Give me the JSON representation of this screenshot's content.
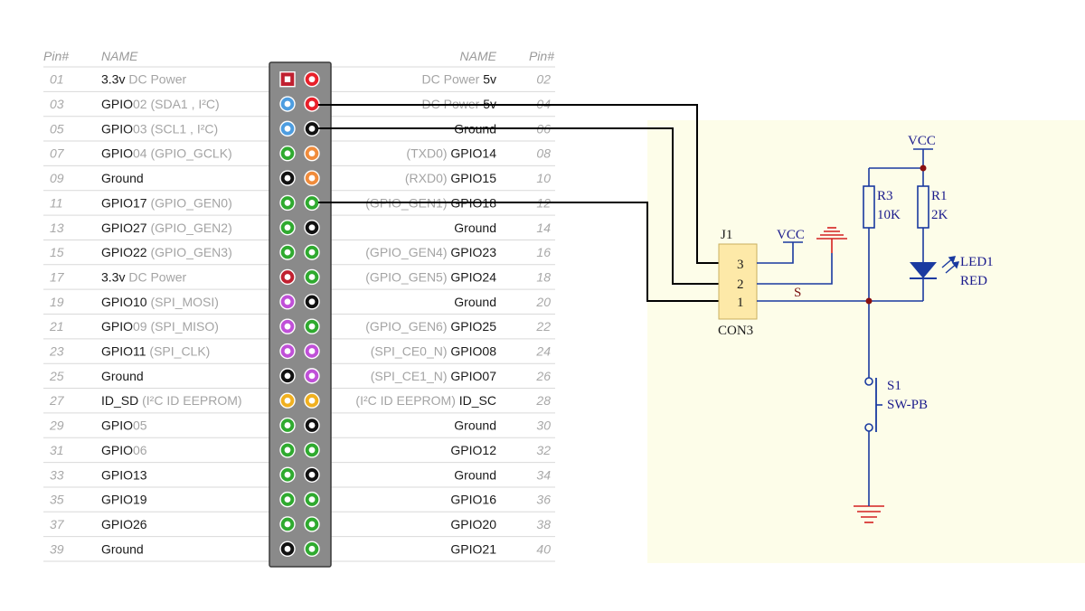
{
  "header": {
    "pin_left": "Pin#",
    "name_left": "NAME",
    "name_right": "NAME",
    "pin_right": "Pin#"
  },
  "colors": {
    "red": "#e8202a",
    "blue": "#4d9de0",
    "green": "#2faa2f",
    "orange": "#f08c3c",
    "black": "#111111",
    "purple": "#c050d8",
    "yellow": "#f0b020",
    "darkred": "#c02030"
  },
  "pins": [
    {
      "left_num": "01",
      "left_main": "3.3v",
      "left_dim": " DC Power",
      "left_color": "darkred",
      "left_square": true,
      "right_num": "02",
      "right_dim": "DC Power ",
      "right_main": "5v",
      "right_color": "red"
    },
    {
      "left_num": "03",
      "left_main": "GPIO",
      "left_dim": "02 (SDA1 , I²C)",
      "left_color": "blue",
      "right_num": "04",
      "right_dim": "DC Power ",
      "right_main": "5v",
      "right_color": "red"
    },
    {
      "left_num": "05",
      "left_main": "GPIO",
      "left_dim": "03 (SCL1 , I²C)",
      "left_color": "blue",
      "right_num": "06",
      "right_dim": "",
      "right_main": "Ground",
      "right_color": "black"
    },
    {
      "left_num": "07",
      "left_main": "GPIO",
      "left_dim": "04 (GPIO_GCLK)",
      "left_color": "green",
      "right_num": "08",
      "right_dim": "(TXD0) ",
      "right_main": "GPIO14",
      "right_color": "orange"
    },
    {
      "left_num": "09",
      "left_main": "Ground",
      "left_dim": "",
      "left_color": "black",
      "right_num": "10",
      "right_dim": "(RXD0) ",
      "right_main": "GPIO15",
      "right_color": "orange"
    },
    {
      "left_num": "11",
      "left_main": "GPIO17",
      "left_dim": " (GPIO_GEN0)",
      "left_color": "green",
      "right_num": "12",
      "right_dim": "(GPIO_GEN1) ",
      "right_main": "GPIO18",
      "right_color": "green"
    },
    {
      "left_num": "13",
      "left_main": "GPIO27",
      "left_dim": " (GPIO_GEN2)",
      "left_color": "green",
      "right_num": "14",
      "right_dim": "",
      "right_main": "Ground",
      "right_color": "black"
    },
    {
      "left_num": "15",
      "left_main": "GPIO22",
      "left_dim": " (GPIO_GEN3)",
      "left_color": "green",
      "right_num": "16",
      "right_dim": "(GPIO_GEN4) ",
      "right_main": "GPIO23",
      "right_color": "green"
    },
    {
      "left_num": "17",
      "left_main": "3.3v",
      "left_dim": " DC Power",
      "left_color": "darkred",
      "right_num": "18",
      "right_dim": "(GPIO_GEN5) ",
      "right_main": "GPIO24",
      "right_color": "green"
    },
    {
      "left_num": "19",
      "left_main": "GPIO10",
      "left_dim": " (SPI_MOSI)",
      "left_color": "purple",
      "right_num": "20",
      "right_dim": "",
      "right_main": "Ground",
      "right_color": "black"
    },
    {
      "left_num": "21",
      "left_main": "GPIO",
      "left_dim": "09 (SPI_MISO)",
      "left_color": "purple",
      "right_num": "22",
      "right_dim": "(GPIO_GEN6) ",
      "right_main": "GPIO25",
      "right_color": "green"
    },
    {
      "left_num": "23",
      "left_main": "GPIO11",
      "left_dim": " (SPI_CLK)",
      "left_color": "purple",
      "right_num": "24",
      "right_dim": "(SPI_CE0_N) ",
      "right_main": "GPIO08",
      "right_color": "purple"
    },
    {
      "left_num": "25",
      "left_main": "Ground",
      "left_dim": "",
      "left_color": "black",
      "right_num": "26",
      "right_dim": "(SPI_CE1_N) ",
      "right_main": "GPIO07",
      "right_color": "purple"
    },
    {
      "left_num": "27",
      "left_main": "ID_SD",
      "left_dim": " (I²C ID EEPROM)",
      "left_color": "yellow",
      "right_num": "28",
      "right_dim": "(I²C ID EEPROM) ",
      "right_main": "ID_SC",
      "right_color": "yellow"
    },
    {
      "left_num": "29",
      "left_main": "GPIO",
      "left_dim": "05",
      "left_color": "green",
      "right_num": "30",
      "right_dim": "",
      "right_main": "Ground",
      "right_color": "black"
    },
    {
      "left_num": "31",
      "left_main": "GPIO",
      "left_dim": "06",
      "left_color": "green",
      "right_num": "32",
      "right_dim": "",
      "right_main": "GPIO12",
      "right_color": "green"
    },
    {
      "left_num": "33",
      "left_main": "GPIO13",
      "left_dim": "",
      "left_color": "green",
      "right_num": "34",
      "right_dim": "",
      "right_main": "Ground",
      "right_color": "black"
    },
    {
      "left_num": "35",
      "left_main": "GPIO19",
      "left_dim": "",
      "left_color": "green",
      "right_num": "36",
      "right_dim": "",
      "right_main": "GPIO16",
      "right_color": "green"
    },
    {
      "left_num": "37",
      "left_main": "GPIO26",
      "left_dim": "",
      "left_color": "green",
      "right_num": "38",
      "right_dim": "",
      "right_main": "GPIO20",
      "right_color": "green"
    },
    {
      "left_num": "39",
      "left_main": "Ground",
      "left_dim": "",
      "left_color": "black",
      "right_num": "40",
      "right_dim": "",
      "right_main": "GPIO21",
      "right_color": "green"
    }
  ],
  "schematic": {
    "vcc_top": "VCC",
    "r3_ref": "R3",
    "r3_value": "10K",
    "r1_ref": "R1",
    "r1_value": "2K",
    "j1_ref": "J1",
    "j1_part": "CON3",
    "j1_pins": [
      "3",
      "2",
      "1"
    ],
    "vcc_j1": "VCC",
    "net_s": "S",
    "led_ref": "LED1",
    "led_color": "RED",
    "sw_ref": "S1",
    "sw_part": "SW-PB"
  }
}
